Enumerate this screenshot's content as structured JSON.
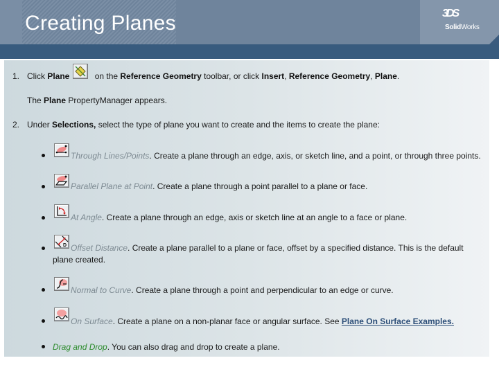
{
  "header": {
    "title": "Creating Planes",
    "logo_mark": "3DS",
    "logo_text_bold": "Solid",
    "logo_text_normal": "Works"
  },
  "steps": [
    {
      "number": "1.",
      "parts": {
        "a": "Click ",
        "b": "Plane",
        "c": " on the ",
        "d": "Reference Geometry",
        "e": " toolbar, or click ",
        "f": "Insert",
        "g": ", ",
        "h": "Reference Geometry",
        "i": ", ",
        "j": "Plane",
        "k": "."
      },
      "icon": "plane-tool-icon",
      "note": {
        "a": "The ",
        "b": "Plane",
        "c": " PropertyManager appears."
      }
    },
    {
      "number": "2.",
      "parts": {
        "a": "Under ",
        "b": "Selections,",
        "c": " select the type of plane you want to create and the items to create the plane:"
      }
    }
  ],
  "options": [
    {
      "icon": "through-lines-points-icon",
      "name": "Through Lines/Points",
      "desc": ". Create a plane through an edge, axis, or sketch line, and a point, or through three points."
    },
    {
      "icon": "parallel-plane-at-point-icon",
      "name": "Parallel Plane at Point",
      "desc": ". Create a plane through a point parallel to a plane or face."
    },
    {
      "icon": "at-angle-icon",
      "name": "At Angle",
      "desc": ". Create a plane through an edge, axis  or sketch line at an angle to a face or plane."
    },
    {
      "icon": "offset-distance-icon",
      "name": "Offset Distance",
      "desc": ". Create a plane parallel to a plane or face, offset by a specified distance. This is the default",
      "desc2": "plane created."
    },
    {
      "icon": "normal-to-curve-icon",
      "name": "Normal to Curve",
      "desc": ". Create a plane through a point and perpendicular to an edge or curve."
    },
    {
      "icon": "on-surface-icon",
      "name": "On Surface",
      "desc": ". Create a plane on a non-planar face or angular surface. See ",
      "link": "Plane On Surface Examples."
    },
    {
      "name": "Drag and Drop",
      "desc": ". You can also drag and drop to create a plane."
    }
  ],
  "colors": {
    "header_bg": "#6f849c",
    "header_bar": "#385b7e",
    "option_name": "#7d8a92",
    "drag_drop": "#2a8a2a",
    "link": "#2c4e78"
  }
}
